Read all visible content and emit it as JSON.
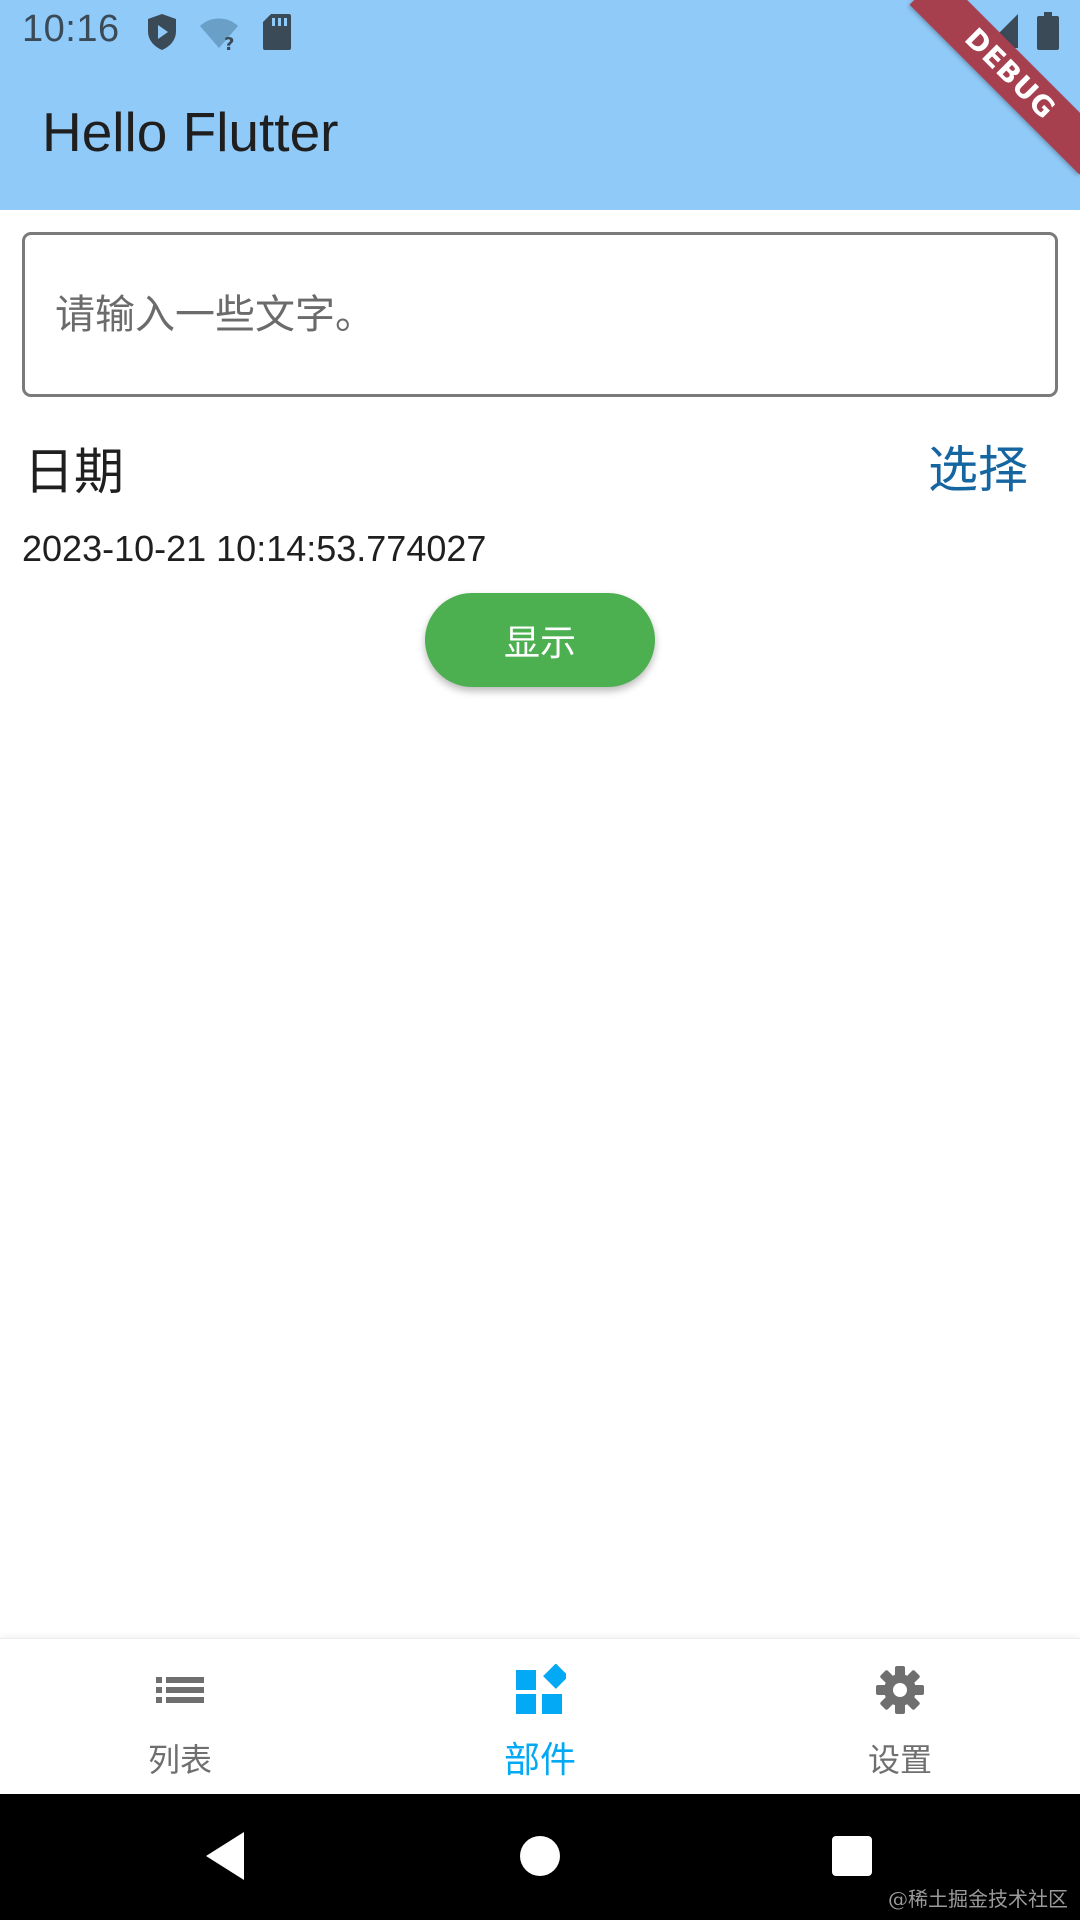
{
  "status_bar": {
    "time": "10:16",
    "icons": [
      "play-protect-icon",
      "wifi-unknown-icon",
      "sd-card-icon",
      "wifi-icon",
      "cell-signal-icon",
      "battery-icon"
    ]
  },
  "app_bar": {
    "title": "Hello Flutter",
    "debug_banner": "DEBUG",
    "background_color": "#90CAF9"
  },
  "text_field": {
    "placeholder": "请输入一些文字。",
    "value": ""
  },
  "date_row": {
    "label": "日期",
    "select_label": "选择",
    "select_color": "#1565A0"
  },
  "date_value": "2023-10-21 10:14:53.774027",
  "show_button": {
    "label": "显示",
    "color": "#4CAF50"
  },
  "bottom_nav": {
    "items": [
      {
        "label": "列表",
        "icon": "list-icon",
        "active": false
      },
      {
        "label": "部件",
        "icon": "widgets-icon",
        "active": true
      },
      {
        "label": "设置",
        "icon": "settings-icon",
        "active": false
      }
    ],
    "active_color": "#03A9F4",
    "inactive_color": "#6F6F6F"
  },
  "system_nav": {
    "buttons": [
      "back-icon",
      "home-icon",
      "recents-icon"
    ]
  },
  "watermark": "@稀土掘金技术社区"
}
